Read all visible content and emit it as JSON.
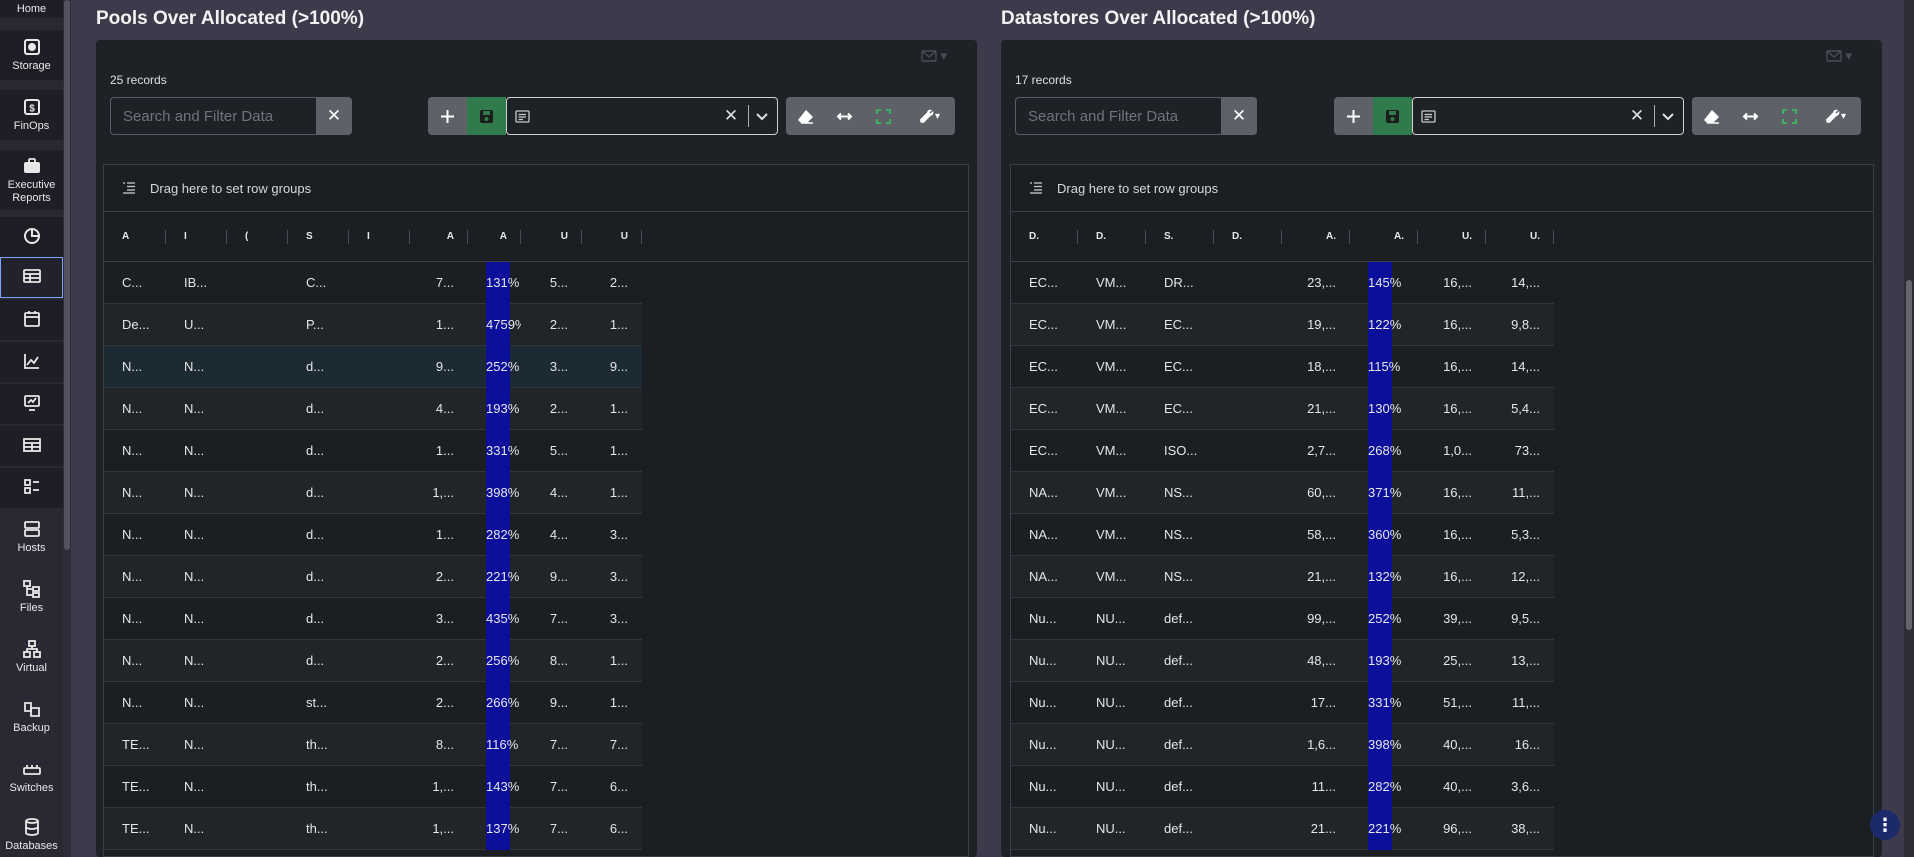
{
  "sidebar": {
    "items": [
      {
        "label": "Home"
      },
      {
        "label": "Storage"
      },
      {
        "label": "FinOps"
      },
      {
        "label": "Executive Reports"
      },
      {
        "label": ""
      },
      {
        "label": ""
      },
      {
        "label": ""
      },
      {
        "label": ""
      },
      {
        "label": ""
      },
      {
        "label": ""
      },
      {
        "label": ""
      },
      {
        "label": "Hosts"
      },
      {
        "label": "Files"
      },
      {
        "label": "Virtual"
      },
      {
        "label": "Backup"
      },
      {
        "label": "Switches"
      },
      {
        "label": "Databases"
      }
    ]
  },
  "pools": {
    "title": "Pools Over Allocated (>100%)",
    "records": "25 records",
    "search_placeholder": "Search and Filter Data",
    "group_hint": "Drag here to set row groups",
    "headers": [
      "A",
      "I",
      "(",
      "S",
      "I",
      "A",
      "A",
      "U",
      "U"
    ],
    "rows": [
      {
        "c": [
          "C...",
          "IB...",
          "",
          "C...",
          "",
          "7...",
          "131%",
          "5...",
          "2..."
        ],
        "pct": 131
      },
      {
        "c": [
          "De...",
          "U...",
          "",
          "P...",
          "",
          "1...",
          "4759%",
          "2...",
          "1..."
        ],
        "pct": 4759
      },
      {
        "c": [
          "N...",
          "N...",
          "",
          "d...",
          "",
          "9...",
          "252%",
          "3...",
          "9..."
        ],
        "pct": 252
      },
      {
        "c": [
          "N...",
          "N...",
          "",
          "d...",
          "",
          "4...",
          "193%",
          "2...",
          "1..."
        ],
        "pct": 193
      },
      {
        "c": [
          "N...",
          "N...",
          "",
          "d...",
          "",
          "1...",
          "331%",
          "5...",
          "1..."
        ],
        "pct": 331
      },
      {
        "c": [
          "N...",
          "N...",
          "",
          "d...",
          "",
          "1,...",
          "398%",
          "4...",
          "1..."
        ],
        "pct": 398
      },
      {
        "c": [
          "N...",
          "N...",
          "",
          "d...",
          "",
          "1...",
          "282%",
          "4...",
          "3..."
        ],
        "pct": 282
      },
      {
        "c": [
          "N...",
          "N...",
          "",
          "d...",
          "",
          "2...",
          "221%",
          "9...",
          "3..."
        ],
        "pct": 221
      },
      {
        "c": [
          "N...",
          "N...",
          "",
          "d...",
          "",
          "3...",
          "435%",
          "7...",
          "3..."
        ],
        "pct": 435
      },
      {
        "c": [
          "N...",
          "N...",
          "",
          "d...",
          "",
          "2...",
          "256%",
          "8...",
          "1..."
        ],
        "pct": 256
      },
      {
        "c": [
          "N...",
          "N...",
          "",
          "st...",
          "",
          "2...",
          "266%",
          "9...",
          "1..."
        ],
        "pct": 266
      },
      {
        "c": [
          "TE...",
          "N...",
          "",
          "th...",
          "",
          "8...",
          "116%",
          "7...",
          "7..."
        ],
        "pct": 116
      },
      {
        "c": [
          "TE...",
          "N...",
          "",
          "th...",
          "",
          "1,...",
          "143%",
          "7...",
          "6..."
        ],
        "pct": 143
      },
      {
        "c": [
          "TE...",
          "N...",
          "",
          "th...",
          "",
          "1,...",
          "137%",
          "7...",
          "6..."
        ],
        "pct": 137
      }
    ]
  },
  "datastores": {
    "title": "Datastores Over Allocated (>100%)",
    "records": "17 records",
    "search_placeholder": "Search and Filter Data",
    "group_hint": "Drag here to set row groups",
    "headers": [
      "D.",
      "D.",
      "S.",
      "D.",
      "A.",
      "A.",
      "U.",
      "U."
    ],
    "rows": [
      {
        "c": [
          "EC...",
          "VM...",
          "DR...",
          "",
          "23,...",
          "145%",
          "16,...",
          "14,..."
        ],
        "pct": 145
      },
      {
        "c": [
          "EC...",
          "VM...",
          "EC...",
          "",
          "19,...",
          "122%",
          "16,...",
          "9,8..."
        ],
        "pct": 122
      },
      {
        "c": [
          "EC...",
          "VM...",
          "EC...",
          "",
          "18,...",
          "115%",
          "16,...",
          "14,..."
        ],
        "pct": 115
      },
      {
        "c": [
          "EC...",
          "VM...",
          "EC...",
          "",
          "21,...",
          "130%",
          "16,...",
          "5,4..."
        ],
        "pct": 130
      },
      {
        "c": [
          "EC...",
          "VM...",
          "ISO...",
          "",
          "2,7...",
          "268%",
          "1,0...",
          "73..."
        ],
        "pct": 268
      },
      {
        "c": [
          "NA...",
          "VM...",
          "NS...",
          "",
          "60,...",
          "371%",
          "16,...",
          "11,..."
        ],
        "pct": 371
      },
      {
        "c": [
          "NA...",
          "VM...",
          "NS...",
          "",
          "58,...",
          "360%",
          "16,...",
          "5,3..."
        ],
        "pct": 360
      },
      {
        "c": [
          "NA...",
          "VM...",
          "NS...",
          "",
          "21,...",
          "132%",
          "16,...",
          "12,..."
        ],
        "pct": 132
      },
      {
        "c": [
          "Nu...",
          "NU...",
          "def...",
          "",
          "99,...",
          "252%",
          "39,...",
          "9,5..."
        ],
        "pct": 252
      },
      {
        "c": [
          "Nu...",
          "NU...",
          "def...",
          "",
          "48,...",
          "193%",
          "25,...",
          "13,..."
        ],
        "pct": 193
      },
      {
        "c": [
          "Nu...",
          "NU...",
          "def...",
          "",
          "17...",
          "331%",
          "51,...",
          "11,..."
        ],
        "pct": 331
      },
      {
        "c": [
          "Nu...",
          "NU...",
          "def...",
          "",
          "1,6...",
          "398%",
          "40,...",
          "16..."
        ],
        "pct": 398
      },
      {
        "c": [
          "Nu...",
          "NU...",
          "def...",
          "",
          "11...",
          "282%",
          "40,...",
          "3,6..."
        ],
        "pct": 282
      },
      {
        "c": [
          "Nu...",
          "NU...",
          "def...",
          "",
          "21...",
          "221%",
          "96,...",
          "38,..."
        ],
        "pct": 221
      }
    ]
  },
  "colors": {
    "bar": "#0b0f9a",
    "save_green": "#2f7b4b",
    "panel_bg": "#1e2126"
  }
}
